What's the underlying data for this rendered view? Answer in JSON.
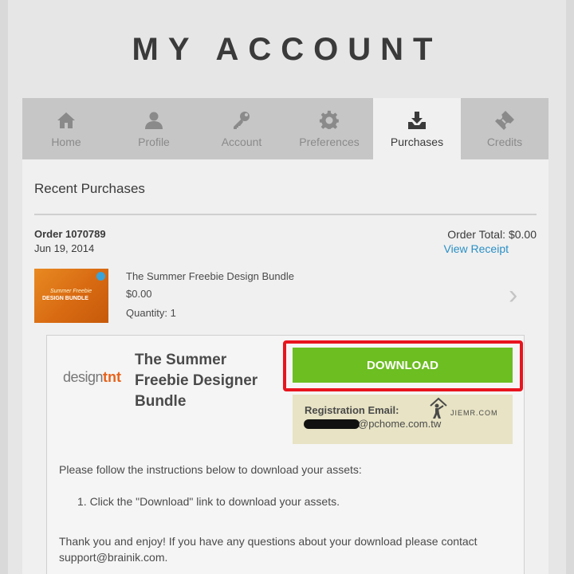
{
  "page": {
    "title": "MY ACCOUNT"
  },
  "tabs": [
    {
      "label": "Home",
      "icon": "home-icon"
    },
    {
      "label": "Profile",
      "icon": "profile-icon"
    },
    {
      "label": "Account",
      "icon": "key-icon"
    },
    {
      "label": "Preferences",
      "icon": "gear-icon"
    },
    {
      "label": "Purchases",
      "icon": "download-tray-icon",
      "active": true
    },
    {
      "label": "Credits",
      "icon": "ticket-icon"
    }
  ],
  "purchases": {
    "heading": "Recent Purchases",
    "order": {
      "number": "Order 1070789",
      "date": "Jun 19, 2014",
      "total": "Order Total: $0.00",
      "receipt_link": "View Receipt"
    },
    "item": {
      "name": "The Summer Freebie Design Bundle",
      "price": "$0.00",
      "quantity": "Quantity: 1",
      "thumb_line1": "Summer Freebie",
      "thumb_line2": "DESIGN BUNDLE"
    }
  },
  "download_card": {
    "logo_part1": "design",
    "logo_part2": "tnt",
    "title": "The Summer Freebie Designer Bundle",
    "button_label": "DOWNLOAD",
    "registration_label": "Registration Email:",
    "registration_email_visible": "@pchome.com.tw",
    "watermark": "JIEMR.COM",
    "instructions": "Please follow the instructions below to download your assets:",
    "step_1": "1.  Click the \"Download\" link to download your assets.",
    "thanks": "Thank you and enjoy! If you have any questions about your download please contact support@brainik.com."
  },
  "colors": {
    "accent_green": "#6cbe21",
    "highlight_red": "#e8141e",
    "link_blue": "#2a8fc5",
    "registration_bg": "#e7e3c4"
  }
}
